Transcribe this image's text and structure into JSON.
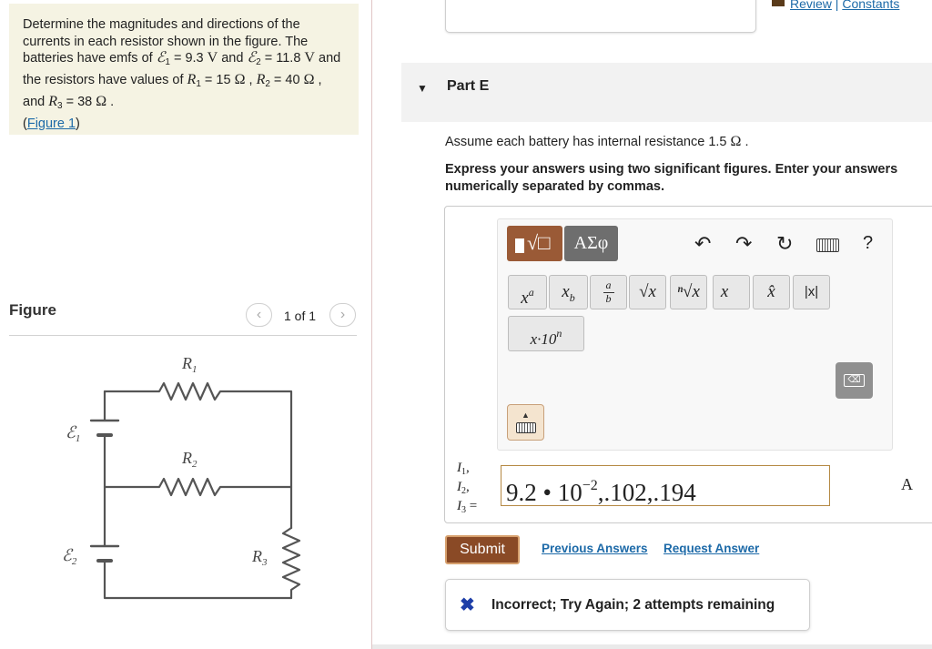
{
  "problem": {
    "text_1": "Determine the magnitudes and directions of the currents in each resistor shown in the figure. The batteries have emfs of ",
    "emf1_symbol": "ℰ",
    "emf1_sub": "1",
    "emf1_value": " = 9.3 ",
    "emf1_unit": "V",
    "text_and": " and ",
    "emf2_symbol": "ℰ",
    "emf2_sub": "2",
    "emf2_value": " = 11.8 ",
    "emf2_unit": "V",
    "text_2": " and the resistors have values of ",
    "r1_symbol": "R",
    "r1_sub": "1",
    "r1_value": " = 15 ",
    "r1_unit": "Ω",
    "text_comma": " , ",
    "r2_symbol": "R",
    "r2_sub": "2",
    "r2_value": " = 40 ",
    "r2_unit": "Ω",
    "text_and2": " , and ",
    "r3_symbol": "R",
    "r3_sub": "3",
    "r3_value": " = 38 ",
    "r3_unit": "Ω",
    "text_end": " .",
    "figure_link_open": "(",
    "figure_link": "Figure 1",
    "figure_link_close": ")"
  },
  "figure": {
    "label": "Figure",
    "pager_prev": "‹",
    "pager_text": "1 of 1",
    "pager_next": "›",
    "circuit_labels": {
      "r1": "R",
      "r1_sub": "1",
      "r2": "R",
      "r2_sub": "2",
      "r3": "R",
      "r3_sub": "3",
      "emf1": "ℰ",
      "emf1_sub": "1",
      "emf2": "ℰ",
      "emf2_sub": "2"
    }
  },
  "header_links": {
    "review": "Review",
    "separator": " | ",
    "constants": "Constants"
  },
  "part": {
    "caret": "▼",
    "title": "Part E",
    "assume": "Assume each battery has internal resistance 1.5 ",
    "assume_unit": "Ω",
    "assume_end": " .",
    "instructions": "Express your answers using two significant figures. Enter your answers numerically separated by commas."
  },
  "toolbar": {
    "template_glyph": "√□",
    "greek_label": "ΑΣφ",
    "undo": "↶",
    "redo": "↷",
    "reset": "↻",
    "help": "?",
    "power_base": "x",
    "power_exp": "a",
    "sub_base": "x",
    "sub_index": "b",
    "frac_num": "a",
    "frac_den": "b",
    "sqrt": "√x",
    "nroot": "ⁿ√x",
    "vector": "x⃗",
    "unit_vector": "x̂",
    "abs": "|x|",
    "sci_base": "x·10",
    "sci_exp": "n",
    "backspace": "⌫"
  },
  "answer": {
    "var1": "I",
    "var1_sub": "1",
    "var2": "I",
    "var2_sub": "2",
    "var3": "I",
    "var3_sub": "3",
    "equals": " =",
    "value_mantissa": "9.2 • 10",
    "value_exponent": "−2",
    "value_rest": ",.102,.194",
    "unit": "A"
  },
  "actions": {
    "submit": "Submit",
    "previous_answers": "Previous Answers",
    "request_answer": "Request Answer"
  },
  "feedback": {
    "icon": "✖",
    "text": "Incorrect; Try Again; 2 attempts remaining",
    "icon_color": "#1d3ea8"
  },
  "colors": {
    "problem_bg": "#f5f3e3",
    "accent_brown": "#8a4a26",
    "link_blue": "#1d6aa8"
  }
}
